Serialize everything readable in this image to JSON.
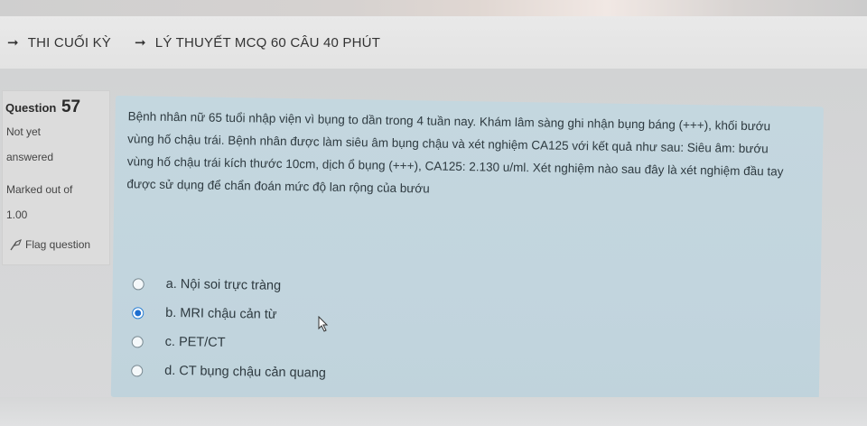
{
  "breadcrumb": {
    "items": [
      {
        "label": "THI CUỐI KỲ"
      },
      {
        "label": "LÝ THUYẾT MCQ 60 CÂU 40 PHÚT"
      }
    ]
  },
  "question_info": {
    "label": "Question",
    "number": "57",
    "status_line1": "Not yet",
    "status_line2": "answered",
    "marked_label": "Marked out of",
    "marked_value": "1.00",
    "flag_label": "Flag question"
  },
  "question": {
    "text": "Bệnh nhân nữ 65 tuổi nhập viện vì bụng to dần trong 4 tuần nay. Khám lâm sàng ghi nhận bụng báng (+++), khối bướu vùng hố chậu trái. Bệnh nhân được làm siêu âm bụng chậu và xét nghiệm CA125 với kết quả như sau: Siêu âm: bướu vùng hố chậu trái kích thước 10cm, dịch ổ bụng (+++), CA125: 2.130 u/ml. Xét nghiệm nào sau đây là xét nghiệm đầu tay được sử dụng để chẩn đoán mức độ lan rộng của bướu"
  },
  "answers": [
    {
      "label": "a. Nội soi trực tràng",
      "selected": false
    },
    {
      "label": "b. MRI chậu cản từ",
      "selected": true
    },
    {
      "label": "c. PET/CT",
      "selected": false
    },
    {
      "label": "d. CT bụng chậu cản quang",
      "selected": false
    }
  ],
  "colors": {
    "question_box": "#c4d7df",
    "radio_selected": "#1e6fd0",
    "page_background": "#d9dadb"
  }
}
